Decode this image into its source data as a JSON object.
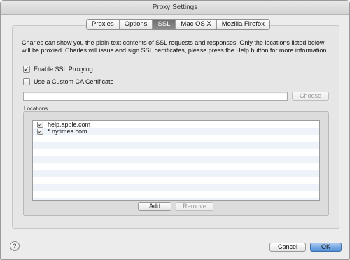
{
  "window": {
    "title": "Proxy Settings"
  },
  "tabs": [
    {
      "label": "Proxies"
    },
    {
      "label": "Options"
    },
    {
      "label": "SSL"
    },
    {
      "label": "Mac OS X"
    },
    {
      "label": "Mozilla Firefox"
    }
  ],
  "selected_tab": "SSL",
  "ssl": {
    "description": "Charles can show you the plain text contents of SSL requests and responses. Only the locations listed below will be proxied. Charles will issue and sign SSL certificates, please press the Help button for more information.",
    "enable_ssl_label": "Enable SSL Proxying",
    "enable_ssl_checked": true,
    "custom_ca_label": "Use a Custom CA Certificate",
    "custom_ca_checked": false,
    "certificate_path": "",
    "choose_label": "Choose",
    "locations_label": "Locations",
    "locations": [
      {
        "host": "help.apple.com",
        "checked": true
      },
      {
        "host": "*.nytimes.com",
        "checked": true
      }
    ],
    "add_label": "Add",
    "remove_label": "Remove"
  },
  "footer": {
    "help_label": "?",
    "cancel_label": "Cancel",
    "ok_label": "OK"
  },
  "check_glyph": "✓"
}
